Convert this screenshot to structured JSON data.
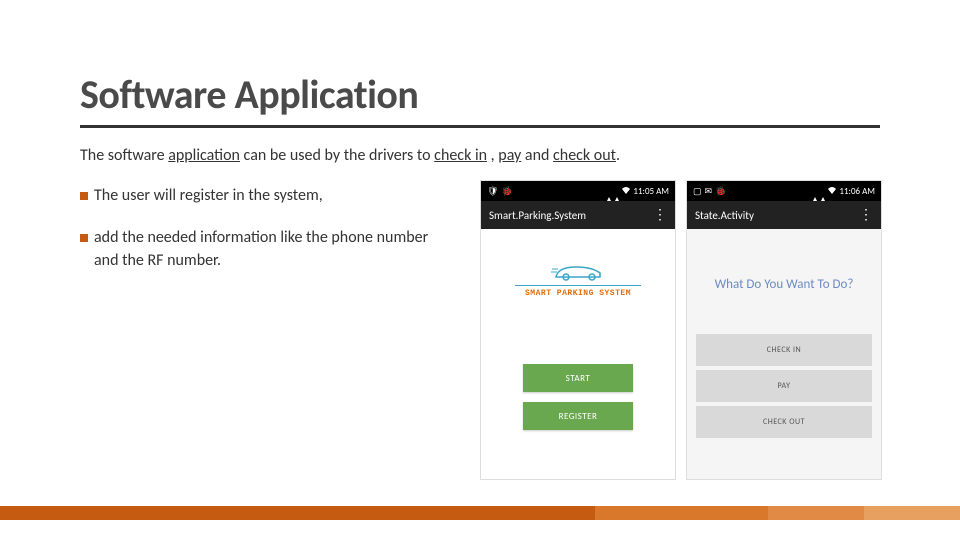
{
  "title": "Software Application",
  "intro": {
    "pre": " The software ",
    "u1": "application",
    "mid1": " can be used by the drivers to ",
    "u2": "check in",
    "mid2": " , ",
    "u3": "pay",
    "mid3": " and ",
    "u4": "check out",
    "end": "."
  },
  "bullets": [
    "The user will register in the system,",
    "add the needed information like the phone number and the RF number."
  ],
  "phone1": {
    "time": "11:05 AM",
    "appbar_title": "Smart.Parking.System",
    "logo_text": "SMART PARKING SYSTEM",
    "buttons": [
      "START",
      "REGISTER"
    ]
  },
  "phone2": {
    "time": "11:06 AM",
    "appbar_title": "State.Activity",
    "prompt": "What Do You Want To Do?",
    "buttons": [
      "CHECK IN",
      "PAY",
      "CHECK OUT"
    ]
  }
}
